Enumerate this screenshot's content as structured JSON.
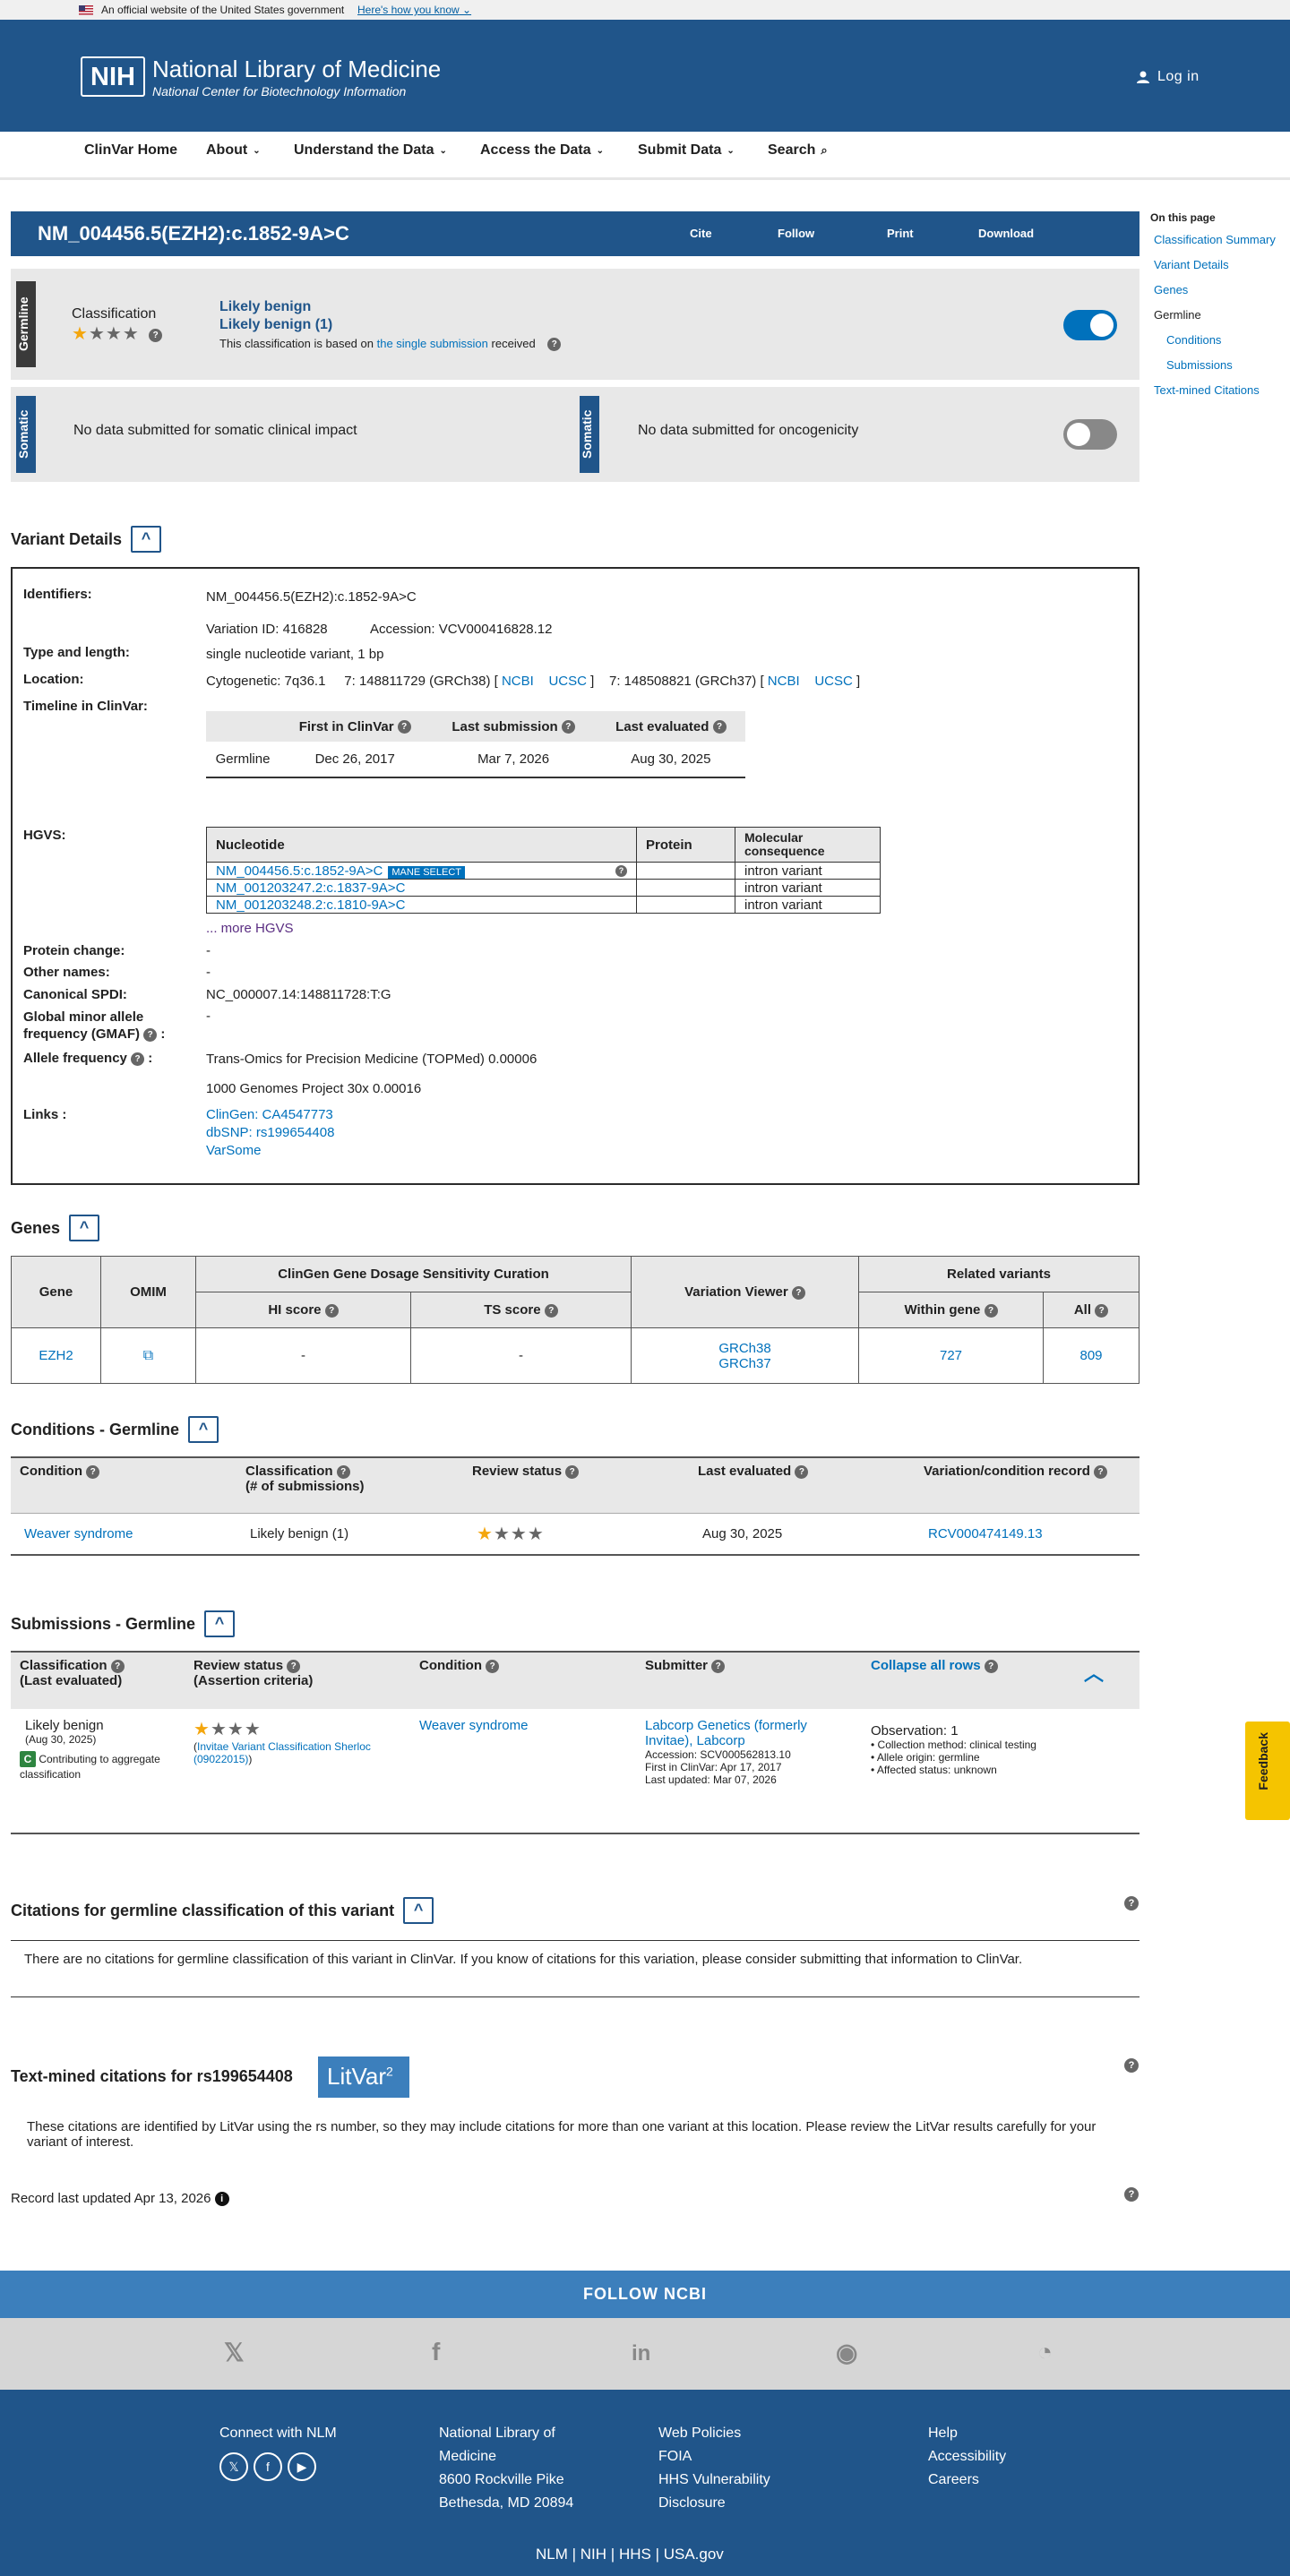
{
  "gov_banner": {
    "text": "An official website of the United States government",
    "know_link": "Here's how you know"
  },
  "header": {
    "logo": "NIH",
    "title": "National Library of Medicine",
    "subtitle": "National Center for Biotechnology Information",
    "login": "Log in"
  },
  "nav": {
    "items": [
      "ClinVar Home",
      "About",
      "Understand the Data",
      "Access the Data",
      "Submit Data",
      "Search"
    ]
  },
  "variant": {
    "title": "NM_004456.5(EZH2):c.1852-9A>C",
    "actions": [
      "Cite",
      "Follow",
      "Print",
      "Download"
    ]
  },
  "germline": {
    "tab": "Germline",
    "label": "Classification",
    "classification": "Likely benign",
    "count": "Likely benign (1)",
    "note_prefix": "This classification is based on",
    "note_link": "the single submission",
    "note_suffix": "received"
  },
  "somatic": {
    "tab": "Somatic",
    "impact_text": "No data submitted for somatic clinical impact",
    "oncogenicity_text": "No data submitted for oncogenicity"
  },
  "on_this_page": {
    "heading": "On this page",
    "links": [
      "Classification Summary",
      "Variant Details",
      "Genes"
    ],
    "germline": "Germline",
    "sublinks": [
      "Conditions",
      "Submissions"
    ],
    "last": "Text-mined Citations"
  },
  "variant_details": {
    "heading": "Variant Details",
    "labels": {
      "identifiers": "Identifiers:",
      "type": "Type and length:",
      "location": "Location:",
      "timeline": "Timeline in ClinVar:",
      "hgvs": "HGVS:",
      "protein_change": "Protein change:",
      "other_names": "Other names:",
      "spdi": "Canonical SPDI:",
      "gmaf": "Global minor allele frequency (GMAF)",
      "allele_freq": "Allele frequency",
      "links": "Links :"
    },
    "identifier": "NM_004456.5(EZH2):c.1852-9A>C",
    "variation_id": "Variation ID: 416828",
    "accession": "Accession: VCV000416828.12",
    "type": "single nucleotide variant, 1 bp",
    "cytogenetic": "Cytogenetic: 7q36.1",
    "loc38": "7: 148811729 (GRCh38) [",
    "loc37": "7: 148508821 (GRCh37) [",
    "ncbi": "NCBI",
    "ucsc": "UCSC",
    "bracket_close": "]",
    "timeline": {
      "headers": [
        "",
        "First in ClinVar",
        "Last submission",
        "Last evaluated"
      ],
      "row": [
        "Germline",
        "Dec 26, 2017",
        "Mar 7, 2026",
        "Aug 30, 2025"
      ]
    },
    "hgvs": {
      "headers": [
        "Nucleotide",
        "Protein",
        "Molecular consequence"
      ],
      "rows": [
        {
          "nuc": "NM_004456.5:c.1852-9A>C",
          "protein": "",
          "consequence": "intron variant"
        },
        {
          "nuc": "NM_001203247.2:c.1837-9A>C",
          "protein": "",
          "consequence": "intron variant"
        },
        {
          "nuc": "NM_001203248.2:c.1810-9A>C",
          "protein": "",
          "consequence": "intron variant"
        }
      ],
      "mane": "MANE SELECT",
      "more": "... more HGVS"
    },
    "protein_change": "-",
    "other_names": "-",
    "spdi": "NC_000007.14:148811728:T:G",
    "gmaf": "-",
    "allele_freq_1": "Trans-Omics for Precision Medicine (TOPMed) 0.00006",
    "allele_freq_2": "1000 Genomes Project 30x 0.00016",
    "links": [
      "ClinGen: CA4547773",
      "dbSNP: rs199654408",
      "VarSome"
    ]
  },
  "genes": {
    "heading": "Genes",
    "headers": {
      "gene": "Gene",
      "omim": "OMIM",
      "clingen": "ClinGen Gene Dosage Sensitivity Curation",
      "hi": "HI score",
      "ts": "TS score",
      "viewer": "Variation Viewer",
      "related": "Related variants",
      "within": "Within gene",
      "all": "All"
    },
    "row": {
      "gene": "EZH2",
      "hi": "-",
      "ts": "-",
      "grch38": "GRCh38",
      "grch37": "GRCh37",
      "within": "727",
      "all": "809"
    }
  },
  "conditions": {
    "heading": "Conditions - Germline",
    "headers": [
      "Condition",
      "Classification",
      "(# of submissions)",
      "Review status",
      "Last evaluated",
      "Variation/condition record"
    ],
    "row": {
      "condition": "Weaver syndrome",
      "classification": "Likely benign (1)",
      "last_evaluated": "Aug 30, 2025",
      "record": "RCV000474149.13"
    }
  },
  "submissions": {
    "heading": "Submissions - Germline",
    "headers": {
      "classification": "Classification",
      "last_eval": "(Last evaluated)",
      "review": "Review status",
      "criteria": "(Assertion criteria)",
      "condition": "Condition",
      "submitter": "Submitter",
      "collapse": "Collapse all rows"
    },
    "row": {
      "classification": "Likely benign",
      "date": "(Aug 30, 2025)",
      "contrib_badge": "C",
      "contrib": "Contributing to aggregate classification",
      "criteria": "Invitae Variant Classification Sherloc (09022015)",
      "condition": "Weaver syndrome",
      "submitter": "Labcorp Genetics (formerly Invitae), Labcorp",
      "accession": "Accession: SCV000562813.10",
      "first": "First in ClinVar: Apr 17, 2017",
      "updated": "Last updated: Mar 07, 2026",
      "observation": "Observation: 1",
      "obs_items": [
        "Collection method: clinical testing",
        "Allele origin: germline",
        "Affected status: unknown"
      ]
    }
  },
  "citations": {
    "heading": "Citations for germline classification of this variant",
    "text": "There are no citations for germline classification of this variant in ClinVar. If you know of citations for this variation, please consider submitting that information to ClinVar."
  },
  "textmined": {
    "heading": "Text-mined citations for rs199654408",
    "litvar": "LitVar",
    "litvar_sup": "2",
    "text": "These citations are identified by LitVar using the rs number, so they may include citations for more than one variant at this location. Please review the LitVar results carefully for your variant of interest."
  },
  "record_updated": "Record last updated Apr 13, 2026",
  "footer": {
    "follow": "FOLLOW NCBI",
    "connect": "Connect with NLM",
    "address": [
      "National Library of",
      "Medicine",
      "8600 Rockville Pike",
      "Bethesda, MD 20894"
    ],
    "policies": [
      "Web Policies",
      "FOIA",
      "HHS Vulnerability",
      "Disclosure"
    ],
    "help": [
      "Help",
      "Accessibility",
      "Careers"
    ],
    "bottom": [
      "NLM",
      "NIH",
      "HHS",
      "USA.gov"
    ]
  },
  "feedback": "Feedback",
  "colors": {
    "brand": "#20558a",
    "link": "#0071bc",
    "star": "#f4a60d",
    "panel": "#e8e8e8"
  }
}
